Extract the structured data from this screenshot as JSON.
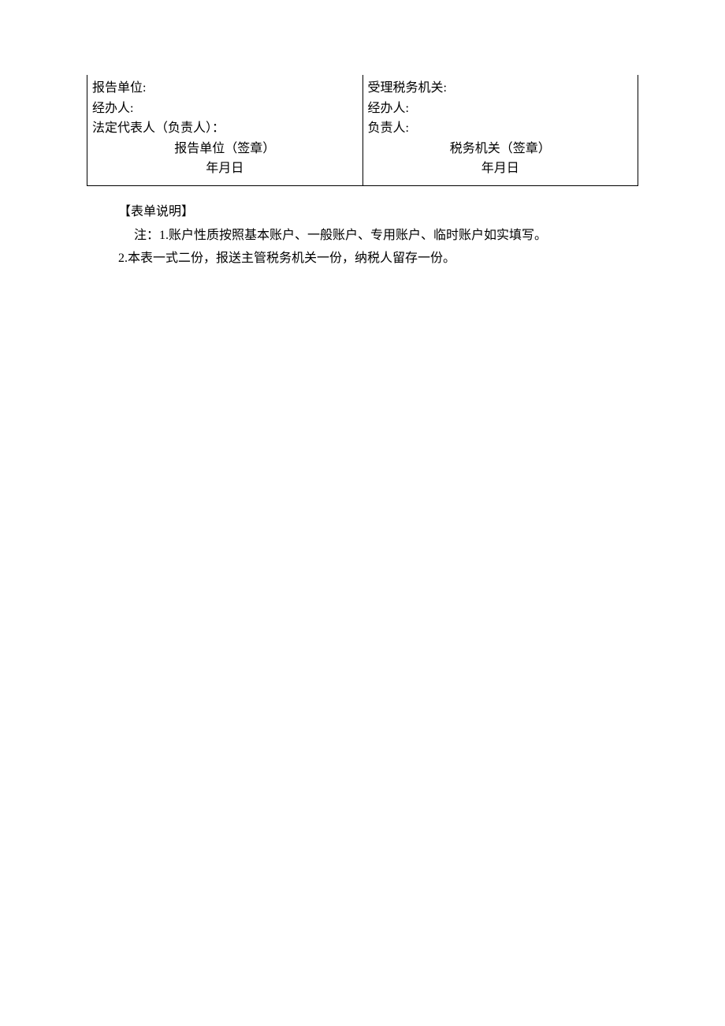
{
  "form": {
    "left": {
      "unit_label": "报告单位:",
      "operator_label": "经办人:",
      "legal_rep_label": "法定代表人（负责人）：",
      "seal_line": "报告单位（签章）",
      "date_line": "年月日"
    },
    "right": {
      "authority_label": "受理税务机关:",
      "operator_label": "经办人:",
      "person_in_charge_label": "负责人:",
      "seal_line": "税务机关（签章）",
      "date_line": "年月日"
    }
  },
  "notes": {
    "title": "【表单说明】",
    "line1": "注：1.账户性质按照基本账户、一般账户、专用账户、临时账户如实填写。",
    "line2": "2.本表一式二份，报送主管税务机关一份，纳税人留存一份。"
  }
}
